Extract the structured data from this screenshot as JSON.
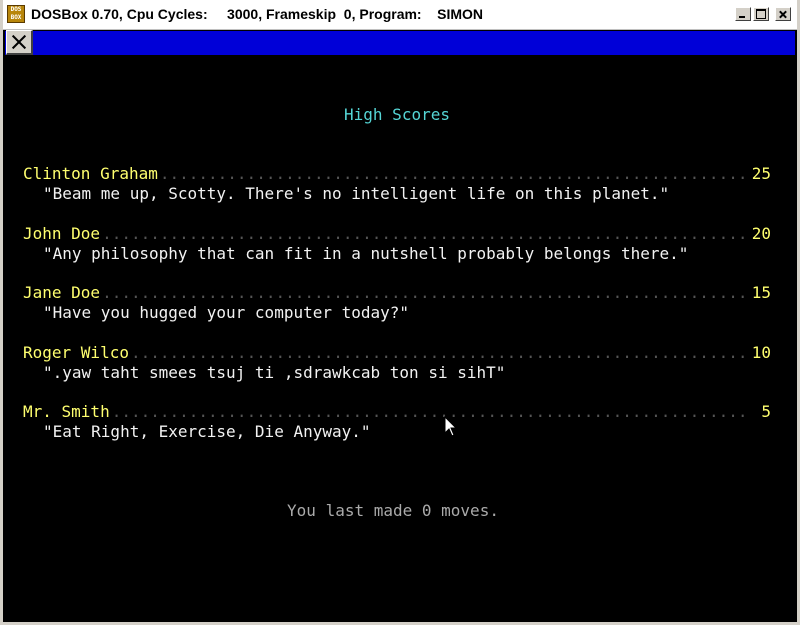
{
  "window": {
    "title": "DOSBox 0.70, Cpu Cycles:     3000, Frameskip  0, Program:    SIMON",
    "icon_label": "DOS BOX",
    "controls": [
      "minimize-icon",
      "maximize-icon",
      "close-icon"
    ]
  },
  "toolbar": {
    "close_icon": "close-icon",
    "strip_color": "#0000d8"
  },
  "game": {
    "heading": "High Scores",
    "entries": [
      {
        "name": "Clinton Graham",
        "score": "25",
        "quote": "\"Beam me up, Scotty. There's no intelligent life on this planet.\""
      },
      {
        "name": "John Doe",
        "score": "20",
        "quote": "\"Any philosophy that can fit in a nutshell probably belongs there.\""
      },
      {
        "name": "Jane Doe",
        "score": "15",
        "quote": "\"Have you hugged your computer today?\""
      },
      {
        "name": "Roger Wilco",
        "score": "10",
        "quote": "\".yaw taht smees tsuj ti ,sdrawkcab ton si sihT\""
      },
      {
        "name": "Mr. Smith",
        "score": "5",
        "quote": "\"Eat Right, Exercise, Die Anyway.\""
      }
    ],
    "footer": "You last made 0 moves."
  },
  "colors": {
    "heading": "#55d5d5",
    "name": "#ffff6f",
    "quote": "#f2f2f2",
    "footer": "#aaaaaa",
    "background": "#000000"
  }
}
